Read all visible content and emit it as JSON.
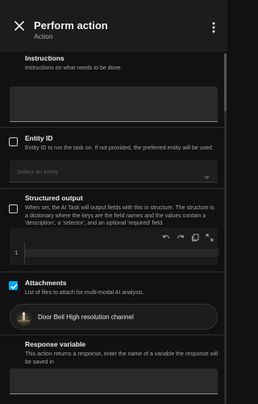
{
  "header": {
    "title": "Perform action",
    "subtitle": "Action"
  },
  "instructions": {
    "label": "Instructions",
    "description": "Instructions on what needs to be done.",
    "value": ""
  },
  "entity_id": {
    "label": "Entity ID",
    "description": "Entity ID to run the task on. If not provided, the preferred entity will be used.",
    "checked": false,
    "select_placeholder": "Select an entity"
  },
  "structured_output": {
    "label": "Structured output",
    "description": "When set, the AI Task will output fields with this in structure. The structure is a dictionary where the keys are the field names and the values contain a 'description', a 'selector', and an optional 'required' field.",
    "checked": false,
    "line_number": "1"
  },
  "attachments": {
    "label": "Attachments",
    "description": "List of files to attach for multi-modal AI analysis.",
    "checked": true,
    "items": [
      {
        "name": "Door Bell High resolution channel"
      }
    ]
  },
  "response_variable": {
    "label": "Response variable",
    "description": "This action returns a response, enter the name of a variable the response will be saved in",
    "value": ""
  },
  "icons": [
    "close-icon",
    "more-vert-icon",
    "undo-icon",
    "redo-icon",
    "copy-icon",
    "fullscreen-icon",
    "check-icon",
    "chevron-down-icon"
  ],
  "colors": {
    "accent": "#03a9f4",
    "background": "#111111",
    "surface": "#1c1c1c"
  }
}
